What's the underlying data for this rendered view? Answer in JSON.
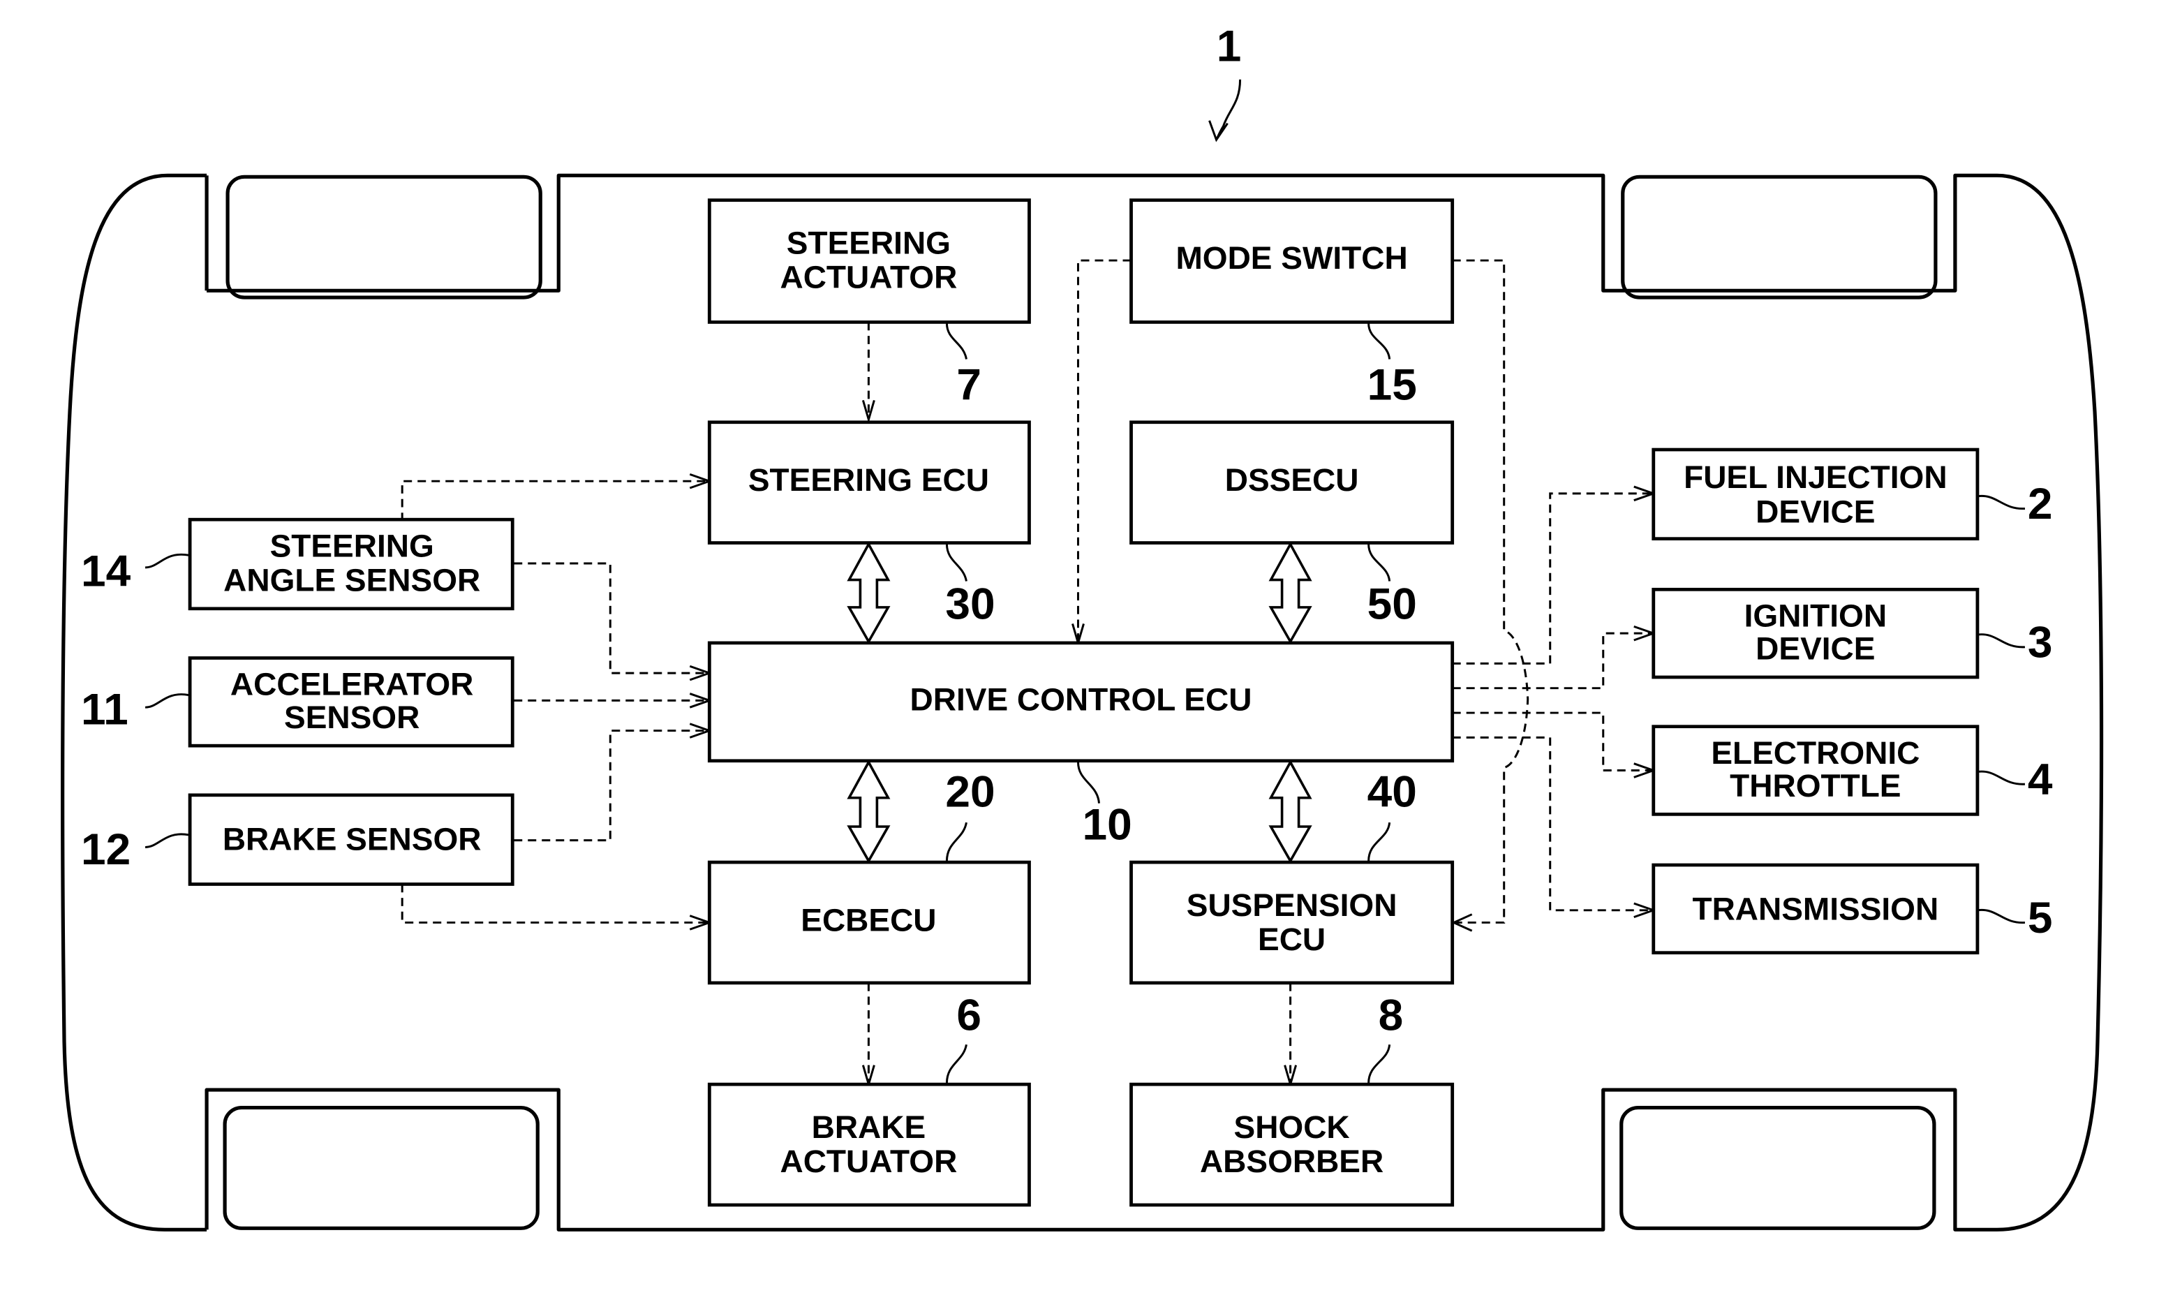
{
  "figure": {
    "vehicle_ref": "1",
    "colors": {
      "line": "#000000",
      "background": "#ffffff"
    }
  },
  "blocks": {
    "steering_actuator": {
      "label_lines": [
        "STEERING",
        "ACTUATOR"
      ],
      "ref": "7"
    },
    "mode_switch": {
      "label_lines": [
        "MODE SWITCH"
      ],
      "ref": "15"
    },
    "steering_ecu": {
      "label_lines": [
        "STEERING ECU"
      ],
      "ref": "30"
    },
    "dssecu": {
      "label_lines": [
        "DSSECU"
      ],
      "ref": "50"
    },
    "drive_control_ecu": {
      "label_lines": [
        "DRIVE CONTROL ECU"
      ],
      "ref": "10"
    },
    "ecbecu": {
      "label_lines": [
        "ECBECU"
      ],
      "ref": "20"
    },
    "suspension_ecu": {
      "label_lines": [
        "SUSPENSION",
        "ECU"
      ],
      "ref": "40"
    },
    "brake_actuator": {
      "label_lines": [
        "BRAKE",
        "ACTUATOR"
      ],
      "ref": "6"
    },
    "shock_absorber": {
      "label_lines": [
        "SHOCK",
        "ABSORBER"
      ],
      "ref": "8"
    },
    "steering_angle_sensor": {
      "label_lines": [
        "STEERING",
        "ANGLE SENSOR"
      ],
      "ref": "14"
    },
    "accelerator_sensor": {
      "label_lines": [
        "ACCELERATOR",
        "SENSOR"
      ],
      "ref": "11"
    },
    "brake_sensor": {
      "label_lines": [
        "BRAKE SENSOR"
      ],
      "ref": "12"
    },
    "fuel_injection_device": {
      "label_lines": [
        "FUEL INJECTION",
        "DEVICE"
      ],
      "ref": "2"
    },
    "ignition_device": {
      "label_lines": [
        "IGNITION",
        "DEVICE"
      ],
      "ref": "3"
    },
    "electronic_throttle": {
      "label_lines": [
        "ELECTRONIC",
        "THROTTLE"
      ],
      "ref": "4"
    },
    "transmission": {
      "label_lines": [
        "TRANSMISSION"
      ],
      "ref": "5"
    }
  },
  "connections": [
    {
      "from": "steering_actuator",
      "to": "steering_ecu",
      "style": "dashed"
    },
    {
      "from": "mode_switch",
      "to": "drive_control_ecu",
      "style": "dashed"
    },
    {
      "from": "mode_switch",
      "to": "suspension_ecu",
      "style": "dashed"
    },
    {
      "from": "steering_angle_sensor",
      "to": "steering_ecu",
      "style": "dashed"
    },
    {
      "from": "steering_angle_sensor",
      "to": "drive_control_ecu",
      "style": "dashed"
    },
    {
      "from": "accelerator_sensor",
      "to": "drive_control_ecu",
      "style": "dashed"
    },
    {
      "from": "brake_sensor",
      "to": "drive_control_ecu",
      "style": "dashed"
    },
    {
      "from": "brake_sensor",
      "to": "ecbecu",
      "style": "dashed"
    },
    {
      "from": "drive_control_ecu",
      "to": "fuel_injection_device",
      "style": "dashed"
    },
    {
      "from": "drive_control_ecu",
      "to": "ignition_device",
      "style": "dashed"
    },
    {
      "from": "drive_control_ecu",
      "to": "electronic_throttle",
      "style": "dashed"
    },
    {
      "from": "drive_control_ecu",
      "to": "transmission",
      "style": "dashed"
    },
    {
      "from": "ecbecu",
      "to": "brake_actuator",
      "style": "dashed"
    },
    {
      "from": "suspension_ecu",
      "to": "shock_absorber",
      "style": "dashed"
    },
    {
      "from": "steering_ecu",
      "to": "drive_control_ecu",
      "style": "bidirectional-bus"
    },
    {
      "from": "dssecu",
      "to": "drive_control_ecu",
      "style": "bidirectional-bus"
    },
    {
      "from": "ecbecu",
      "to": "drive_control_ecu",
      "style": "bidirectional-bus"
    },
    {
      "from": "suspension_ecu",
      "to": "drive_control_ecu",
      "style": "bidirectional-bus"
    }
  ]
}
